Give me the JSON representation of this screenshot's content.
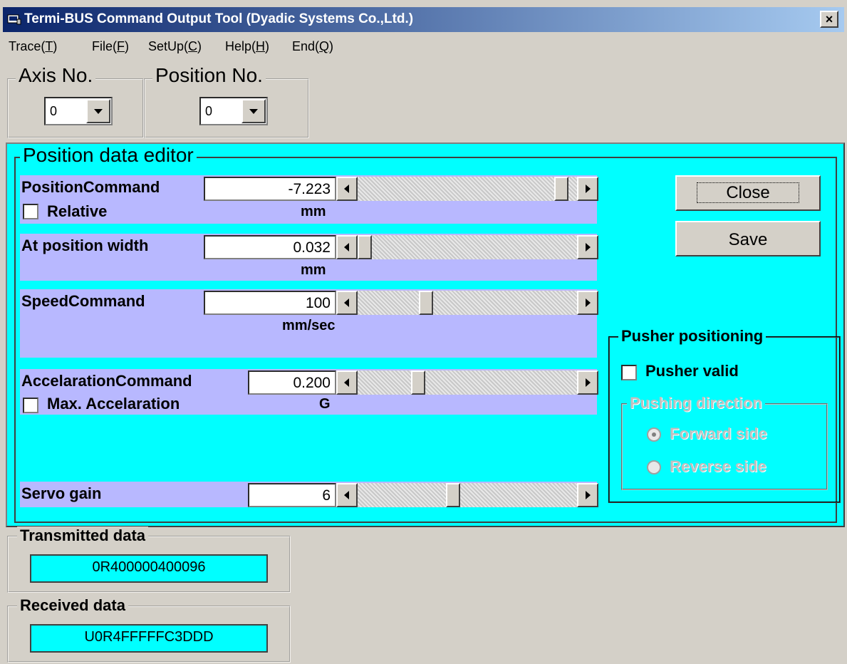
{
  "window": {
    "title": "Termi-BUS Command Output Tool (Dyadic Systems Co.,Ltd.)",
    "close_glyph": "×"
  },
  "menu": {
    "items": [
      {
        "text": "Trace(",
        "key": "T",
        "end": ")"
      },
      {
        "text": "File(",
        "key": "F",
        "end": ")"
      },
      {
        "text": "SetUp(",
        "key": "C",
        "end": ")"
      },
      {
        "text": "Help(",
        "key": "H",
        "end": ")"
      },
      {
        "text": "End(",
        "key": "Q",
        "end": ")"
      }
    ]
  },
  "axis": {
    "label": "Axis No.",
    "value": "0"
  },
  "position": {
    "label": "Position No.",
    "value": "0"
  },
  "editor": {
    "title": "Position data editor",
    "position_command": {
      "label": "PositionCommand",
      "value": "-7.223",
      "unit": "mm",
      "relative_label": "Relative",
      "slider_fraction": 0.96
    },
    "at_position_width": {
      "label": "At position width",
      "value": "0.032",
      "unit": "mm",
      "slider_fraction": 0.0
    },
    "speed_command": {
      "label": "SpeedCommand",
      "value": "100",
      "unit": "mm/sec",
      "slider_fraction": 0.3
    },
    "accel_command": {
      "label": "AccelarationCommand",
      "value": "0.200",
      "unit": "G",
      "max_label": "Max. Accelaration",
      "slider_fraction": 0.26
    },
    "servo_gain": {
      "label": "Servo gain",
      "value": "6",
      "slider_fraction": 0.43
    },
    "close_label": "Close",
    "save_label": "Save",
    "pusher": {
      "title": "Pusher positioning",
      "valid_label": "Pusher valid",
      "direction_title": "Pushing direction",
      "forward_label": "Forward side",
      "reverse_label": "Reverse side",
      "selected": "Forward side"
    }
  },
  "transmitted": {
    "label": "Transmitted data",
    "value": "0R400000400096"
  },
  "received": {
    "label": "Received data",
    "value": "U0R4FFFFFC3DDD"
  }
}
